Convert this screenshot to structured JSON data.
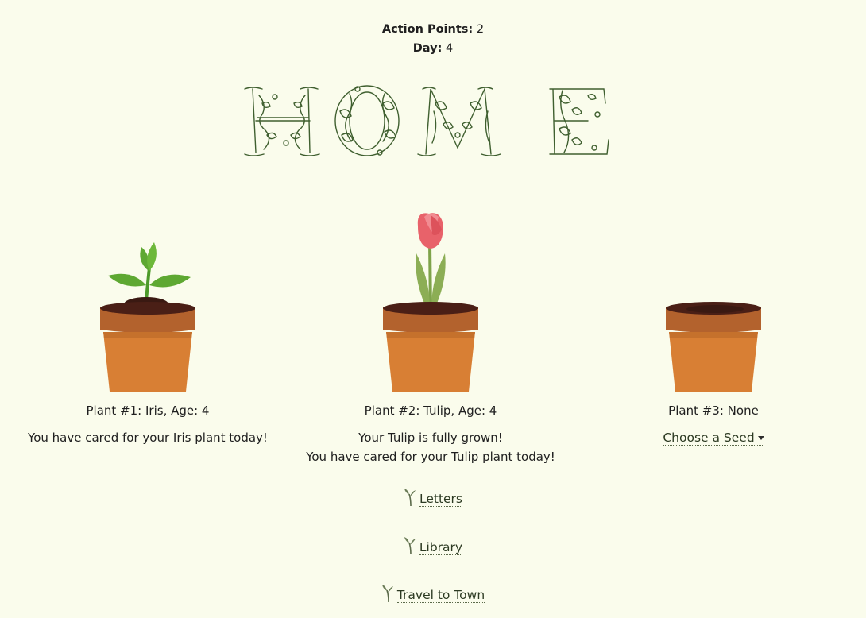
{
  "stats": {
    "action_points_label": "Action Points:",
    "action_points_value": "2",
    "day_label": "Day:",
    "day_value": "4"
  },
  "title": "HOME",
  "plants": [
    {
      "label": "Plant #1: Iris, Age: 4",
      "messages": [
        "You have cared for your Iris plant today!"
      ]
    },
    {
      "label": "Plant #2: Tulip, Age: 4",
      "messages": [
        "Your Tulip is fully grown!",
        "You have cared for your Tulip plant today!"
      ]
    },
    {
      "label": "Plant #3: None",
      "seed_select_label": "Choose a Seed"
    }
  ],
  "nav": {
    "letters": "Letters",
    "library": "Library",
    "travel": "Travel to Town"
  },
  "icons": {
    "nav_icon": "sprout-icon",
    "dropdown_icon": "caret-down-icon"
  },
  "colors": {
    "background": "#fafcec",
    "title_green": "#3f5f2f",
    "pot_orange": "#d87f34",
    "pot_rim": "#b3622d",
    "soil": "#4a1f16",
    "tulip_petal": "#e8626a",
    "leaf_green": "#5ea832"
  }
}
